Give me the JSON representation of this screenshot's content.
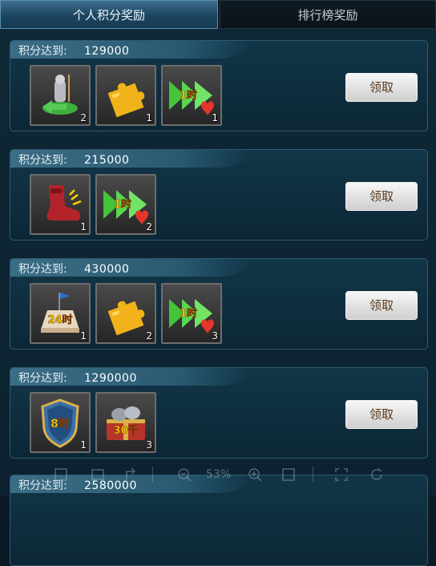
{
  "tabs": [
    {
      "label": "个人积分奖励",
      "active": true
    },
    {
      "label": "排行榜奖励",
      "active": false
    }
  ],
  "score_label": "积分达到:",
  "claim_label": "领取",
  "tiers": [
    {
      "score": "129000",
      "items": [
        {
          "icon": "knight-return-icon",
          "qty": "2"
        },
        {
          "icon": "puzzle-piece-icon",
          "qty": "1"
        },
        {
          "icon": "speedup-1h-icon",
          "qty": "1",
          "label": "1时"
        }
      ]
    },
    {
      "score": "215000",
      "items": [
        {
          "icon": "speed-boot-icon",
          "qty": "1"
        },
        {
          "icon": "speedup-1h-icon",
          "qty": "2",
          "label": "1时"
        }
      ]
    },
    {
      "score": "430000",
      "items": [
        {
          "icon": "camp-24h-icon",
          "qty": "1",
          "label": "24时"
        },
        {
          "icon": "puzzle-piece-icon",
          "qty": "2"
        },
        {
          "icon": "speedup-1h-icon",
          "qty": "3",
          "label": "1时"
        }
      ]
    },
    {
      "score": "1290000",
      "items": [
        {
          "icon": "shield-8h-icon",
          "qty": "1",
          "label": "8时"
        },
        {
          "icon": "iron-chest-30k-icon",
          "qty": "3",
          "label": "30千"
        }
      ]
    },
    {
      "score": "2580000",
      "items": []
    }
  ],
  "toolbar": {
    "zoom": "53%"
  }
}
